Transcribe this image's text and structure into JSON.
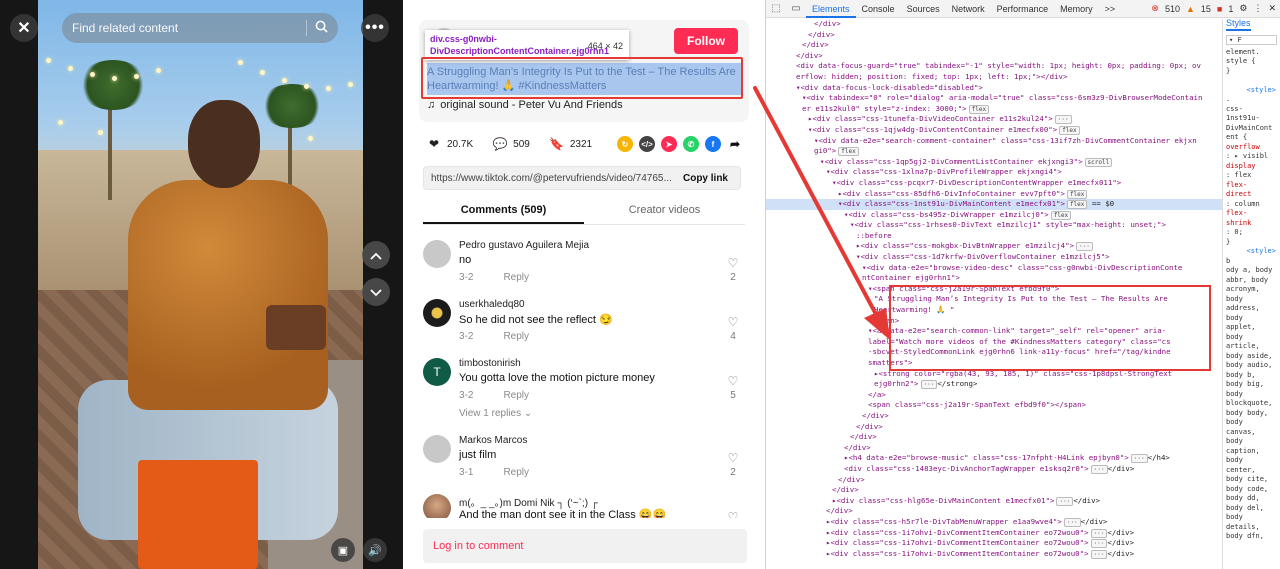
{
  "video": {
    "search_placeholder": "Find related content",
    "icons": {
      "close": "close-icon",
      "more": "more-icon",
      "search": "search-icon",
      "prev": "chevron-up-icon",
      "next": "chevron-down-icon",
      "sound": "volume-icon",
      "pip": "pip-icon"
    }
  },
  "post": {
    "follow_label": "Follow",
    "inspect_tooltip": {
      "selector": "div.css-g0nwbi-DivDescriptionContentContainer.ejg0rhn1",
      "size": "464 × 42"
    },
    "description": "A Struggling Man’s Integrity Is Put to the Test – The Results Are Heartwarming! 🙏 #KindnessMatters",
    "music": "original sound - Peter Vu And Friends",
    "stats": {
      "likes": "20.7K",
      "comments": "509",
      "saves": "2321"
    },
    "share_icons": [
      "tiktok-friends-icon",
      "embed-icon",
      "send-icon",
      "whatsapp-icon",
      "facebook-icon",
      "share-arrow-icon"
    ],
    "link_url": "https://www.tiktok.com/@petervufriends/video/74765...",
    "copy_link_label": "Copy link"
  },
  "tabs": [
    {
      "label": "Comments (509)",
      "active": true
    },
    {
      "label": "Creator videos",
      "active": false
    }
  ],
  "comments": [
    {
      "user": "Pedro gustavo Aguilera Mejia",
      "text": "no",
      "date": "3-2",
      "reply": "Reply",
      "likes": "2",
      "view_replies": ""
    },
    {
      "user": "userkhaledq80",
      "text": "So he did not see the reflect 😏",
      "date": "3-2",
      "reply": "Reply",
      "likes": "4",
      "view_replies": ""
    },
    {
      "user": "timbostonirish",
      "text": "You gotta love the motion picture money",
      "date": "3-2",
      "reply": "Reply",
      "likes": "5",
      "view_replies": "View 1 replies"
    },
    {
      "user": "Markos Marcos",
      "text": "just film",
      "date": "3-1",
      "reply": "Reply",
      "likes": "2",
      "view_replies": ""
    },
    {
      "user": "m(。_ _。)m Domi Nik ┐ (‘~`;) ┌",
      "text": "And the man dont see it in the Class 😄😄",
      "date": "",
      "reply": "",
      "likes": "",
      "view_replies": ""
    }
  ],
  "login_prompt": "Log in to comment",
  "devtools": {
    "tabs": [
      "Elements",
      "Console",
      "Sources",
      "Network",
      "Performance",
      "Memory",
      ">>"
    ],
    "active_tab": "Elements",
    "errors": "510",
    "warnings": "15",
    "info": "1",
    "styles_tab": "Styles",
    "filter_placeholder": "F",
    "lines": [
      {
        "indent": 7,
        "text": "</div>"
      },
      {
        "indent": 6,
        "text": "</div>"
      },
      {
        "indent": 5,
        "text": "</div>"
      },
      {
        "indent": 4,
        "text": "</div>"
      },
      {
        "indent": 4,
        "text": "<div data-focus-guard=\"true\" tabindex=\"-1\" style=\"width: 1px; height: 0px; padding: 0px; ov"
      },
      {
        "indent": 4,
        "text": "erflow: hidden; position: fixed; top: 1px; left: 1px;\"></div>"
      },
      {
        "indent": 4,
        "text": "▾<div data-focus-lock-disabled=\"disabled\">"
      },
      {
        "indent": 5,
        "text": "▾<div tabindex=\"0\" role=\"dialog\" aria-modal=\"true\" class=\"css-6sm3z9-DivBrowserModeContain"
      },
      {
        "indent": 5,
        "text": "er e11s2kul0\" style=\"z-index: 3000;\">",
        "badge": "flex"
      },
      {
        "indent": 6,
        "text": "▸<div class=\"css-1tunefa-DivVideoContainer e11s2kul24\">",
        "badge": "···"
      },
      {
        "indent": 6,
        "text": "▾<div class=\"css-1qjw4dg-DivContentContainer e1mecfx00\">",
        "badge": "flex"
      },
      {
        "indent": 7,
        "text": "▾<div data-e2e=\"search-comment-container\" class=\"css-13if7zh-DivCommentContainer ekjxn"
      },
      {
        "indent": 7,
        "text": "gi0\">",
        "badge": "flex"
      },
      {
        "indent": 8,
        "text": "▾<div class=\"css-1qp5gj2-DivCommentListContainer ekjxngi3\">",
        "badge": "scroll"
      },
      {
        "indent": 9,
        "text": "▾<div class=\"css-1xlna7p-DivProfileWrapper ekjxngi4\">"
      },
      {
        "indent": 10,
        "text": "▾<div class=\"css-pcqxr7-DivDescriptionContentWrapper e1mecfx011\">"
      },
      {
        "indent": 11,
        "text": "▸<div class=\"css-85dfh6-DivInfoContainer evv7pft0\">",
        "badge": "flex"
      },
      {
        "indent": 11,
        "text": "▾<div class=\"css-1nst91u-DivMainContent e1mecfx01\">",
        "badge": "flex",
        "tail": " == $0",
        "selected": true
      },
      {
        "indent": 12,
        "text": "▾<div class=\"css-bs495z-DivWrapper e1mzilcj0\">",
        "badge": "flex"
      },
      {
        "indent": 13,
        "text": "▾<div class=\"css-1rhses0-DivText e1mzilcj1\" style=\"max-height: unset;\">"
      },
      {
        "indent": 14,
        "text": "::before"
      },
      {
        "indent": 14,
        "text": "▸<div class=\"css-mokgbx-DivBtnWrapper e1mzilcj4\">",
        "badge": "···"
      },
      {
        "indent": 14,
        "text": "▾<div class=\"css-1d7krfw-DivOverflowContainer e1mzilcj5\">"
      },
      {
        "indent": 15,
        "text": "▾<div data-e2e=\"browse-video-desc\" class=\"css-g0nwbi-DivDescriptionConte"
      },
      {
        "indent": 15,
        "text": "ntContainer ejg0rhn1\">"
      },
      {
        "indent": 16,
        "text": "▾<span class=\"css-j2a19r-SpanText efbd9f0\">"
      },
      {
        "indent": 17,
        "text": "\"A Struggling Man’s Integrity Is Put to the Test – The Results Are"
      },
      {
        "indent": 17,
        "text": "Heartwarming! 🙏 \""
      },
      {
        "indent": 16,
        "text": "</span>"
      },
      {
        "indent": 16,
        "text": "▾<a data-e2e=\"search-common-link\" target=\"_self\" rel=\"opener\" aria-"
      },
      {
        "indent": 16,
        "text": "label=\"Watch more videos of the #KindnessMatters category\" class=\"cs"
      },
      {
        "indent": 16,
        "text": "-sbcvet-StyledCommonLink ejg0rhn6 link-a11y-focus\" href=\"/tag/kindne"
      },
      {
        "indent": 16,
        "text": "smatters\">"
      },
      {
        "indent": 17,
        "text": "▸<strong color=\"rgba(43, 93, 185, 1)\" class=\"css-1p8dpsl-StrongText"
      },
      {
        "indent": 17,
        "text": "ejg0rhn2\">",
        "badge": "···",
        "tail": "</strong>"
      },
      {
        "indent": 16,
        "text": "</a>"
      },
      {
        "indent": 16,
        "text": "<span class=\"css-j2a19r-SpanText efbd9f0\"></span>"
      },
      {
        "indent": 15,
        "text": "</div>"
      },
      {
        "indent": 14,
        "text": "</div>"
      },
      {
        "indent": 13,
        "text": "</div>"
      },
      {
        "indent": 12,
        "text": "</div>"
      },
      {
        "indent": 12,
        "text": "▸<h4 data-e2e=\"browse-music\" class=\"css-17nfpht-H4Link epjbyn0\">",
        "badge": "···",
        "tail": "</h4>"
      },
      {
        "indent": 12,
        "text": "<div class=\"css-1483eyc-DivAnchorTagWrapper e1sksq2r0\">",
        "badge": "···",
        "tail": "</div>"
      },
      {
        "indent": 11,
        "text": "</div>"
      },
      {
        "indent": 10,
        "text": "</div>"
      },
      {
        "indent": 10,
        "text": "▸<div class=\"css-hlg65e-DivMainContent e1mecfx01\">",
        "badge": "···",
        "tail": "</div>"
      },
      {
        "indent": 9,
        "text": "</div>"
      },
      {
        "indent": 9,
        "text": "▸<div class=\"css-h5r7le-DivTabMenuWrapper e1aa9wve4\">",
        "badge": "···",
        "tail": "</div>"
      },
      {
        "indent": 9,
        "text": "▸<div class=\"css-1i7ohvi-DivCommentItemContainer eo72wou0\">",
        "badge": "···",
        "tail": "</div>"
      },
      {
        "indent": 9,
        "text": "▸<div class=\"css-1i7ohvi-DivCommentItemContainer eo72wou0\">",
        "badge": "···",
        "tail": "</div>"
      },
      {
        "indent": 9,
        "text": "▸<div class=\"css-1i7ohvi-DivCommentItemContainer eo72wou0\">",
        "badge": "···",
        "tail": "</div>"
      }
    ],
    "styles": [
      "element.",
      "style {",
      "}",
      "",
      "<style>",
      ".",
      "css-",
      "1nst91u-",
      "DivMainCont",
      "ent {",
      "overflow",
      ": ▸ visibl",
      "display",
      ": flex",
      "flex-",
      "direct",
      ": column",
      "flex-",
      "shrink",
      ": 0;",
      "}",
      "<style>",
      "b",
      "ody a, body",
      "abbr, body",
      "acronym,",
      "body",
      "address,",
      "body",
      "applet,",
      "body",
      "article,",
      "body aside,",
      "body audio,",
      "body b,",
      "body big,",
      "body",
      "blockquote,",
      "body body,",
      "body",
      "canvas,",
      "body",
      "caption,",
      "body",
      "center,",
      "body cite,",
      "body code,",
      "body dd,",
      "body del,",
      "body",
      "details,",
      "body dfn,"
    ]
  }
}
